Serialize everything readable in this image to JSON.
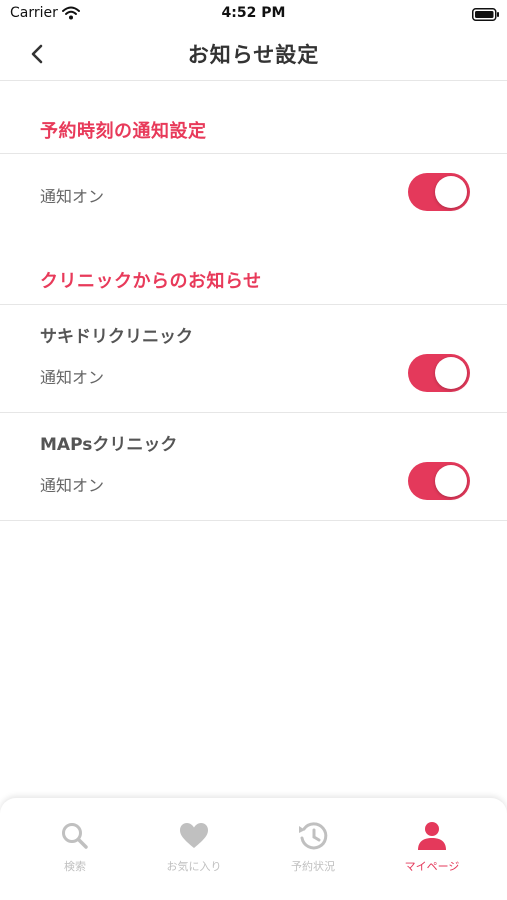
{
  "status_bar": {
    "carrier": "Carrier",
    "time": "4:52 PM"
  },
  "nav": {
    "title": "お知らせ設定",
    "back_icon": "chevron-left-icon"
  },
  "reservation_section": {
    "header": "予約時刻の通知設定",
    "row": {
      "label": "通知オン",
      "enabled": true
    }
  },
  "clinic_section": {
    "header": "クリニックからのお知らせ",
    "clinics": [
      {
        "name": "サキドリクリニック",
        "label": "通知オン",
        "enabled": true
      },
      {
        "name": "MAPsクリニック",
        "label": "通知オン",
        "enabled": true
      }
    ]
  },
  "tab_bar": {
    "tabs": [
      {
        "label": "検索",
        "icon": "search-icon",
        "active": false
      },
      {
        "label": "お気に入り",
        "icon": "heart-icon",
        "active": false
      },
      {
        "label": "予約状況",
        "icon": "history-icon",
        "active": false
      },
      {
        "label": "マイページ",
        "icon": "person-icon",
        "active": true
      }
    ]
  },
  "colors": {
    "accent": "#e4395b",
    "inactive_tab": "#c0c0c0",
    "divider": "#e6e6e6"
  }
}
